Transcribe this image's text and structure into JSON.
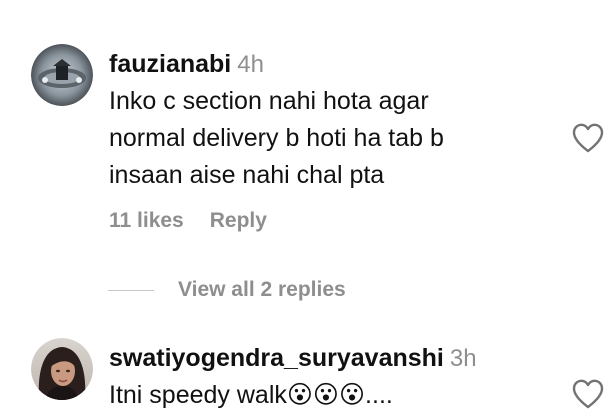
{
  "comments": [
    {
      "username": "fauzianabi",
      "time": "4h",
      "lines": [
        "Inko c section nahi hota agar",
        "normal delivery b hoti ha tab b",
        "insaan aise nahi chal pta"
      ],
      "likes": "11 likes",
      "reply_label": "Reply"
    },
    {
      "username": "swatiyogendra_suryavanshi",
      "time": "3h",
      "text": "Itni speedy walk😮😮😮...."
    }
  ],
  "view_replies_label": "View all 2 replies",
  "icons": {
    "like": "heart-outline-icon"
  },
  "colors": {
    "primary_text": "#111111",
    "secondary_text": "#8e8e8e"
  }
}
